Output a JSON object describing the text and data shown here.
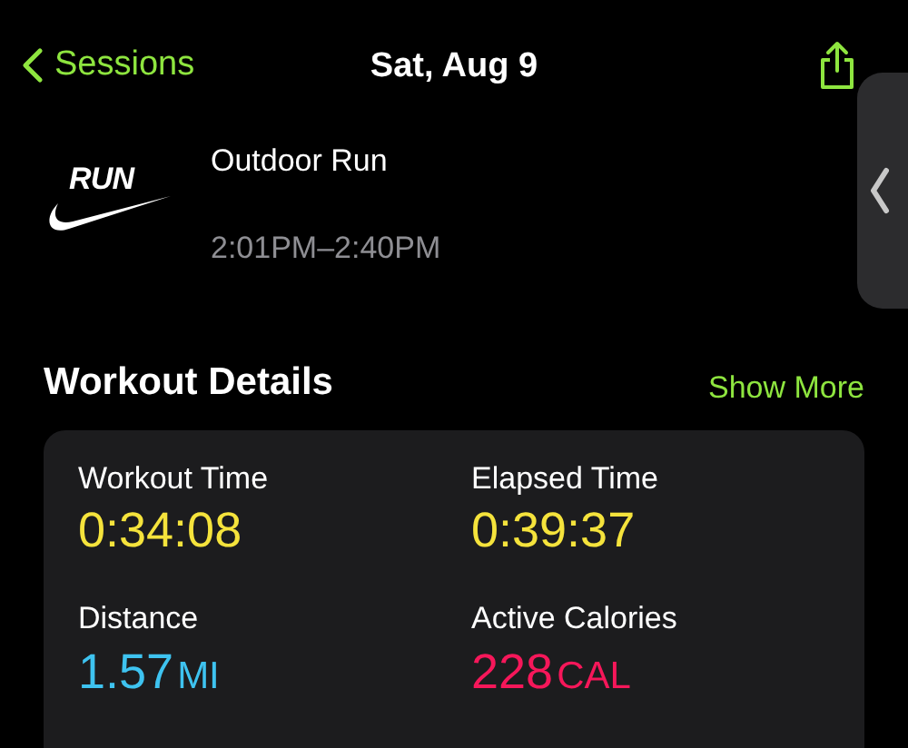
{
  "nav": {
    "back": "Sessions",
    "title": "Sat, Aug 9"
  },
  "workout": {
    "logo_text": "RUN",
    "name": "Outdoor Run",
    "time_range": "2:01PM–2:40PM"
  },
  "details": {
    "title": "Workout Details",
    "action": "Show More",
    "metrics": [
      {
        "label": "Workout Time",
        "value": "0:34:08",
        "color": "#f5e33c"
      },
      {
        "label": "Elapsed Time",
        "value": "0:39:37",
        "color": "#f5e33c"
      },
      {
        "label": "Distance",
        "value": "1.57",
        "unit": "MI",
        "color": "#3ec3f0"
      },
      {
        "label": "Active Calories",
        "value": "228",
        "unit": "CAL",
        "color": "#f6175a"
      }
    ]
  }
}
